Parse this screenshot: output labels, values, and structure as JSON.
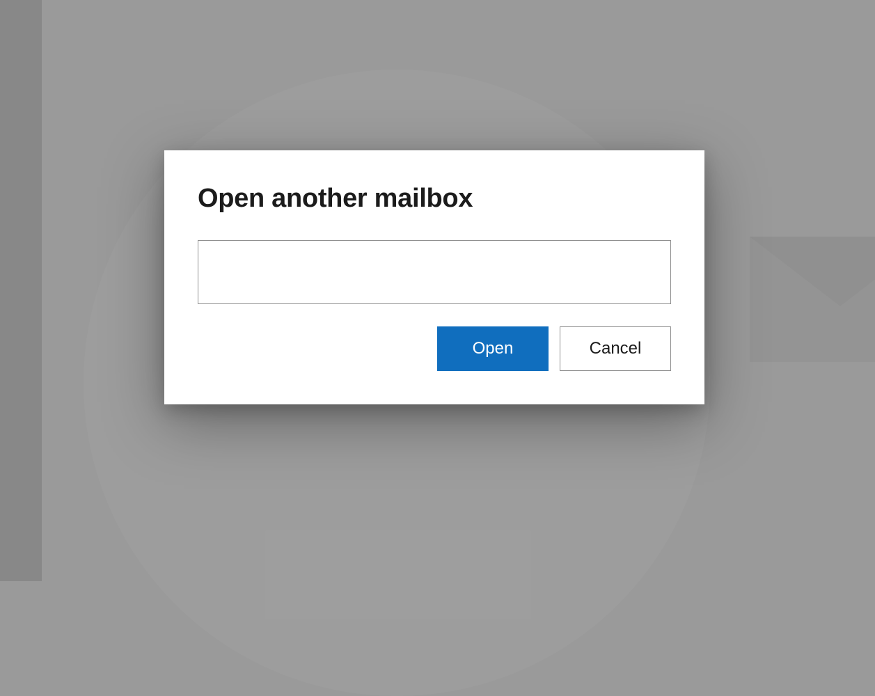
{
  "dialog": {
    "title": "Open another mailbox",
    "input_value": "",
    "input_placeholder": "",
    "open_label": "Open",
    "cancel_label": "Cancel"
  }
}
